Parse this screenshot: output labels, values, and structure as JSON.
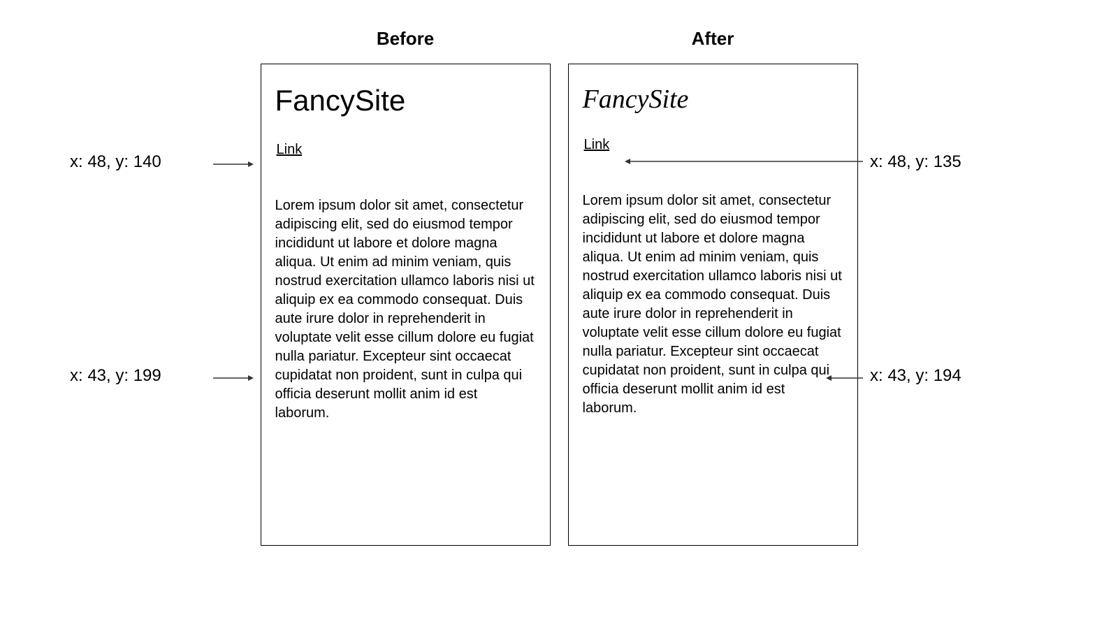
{
  "before": {
    "title": "Before",
    "site_name": "FancySite",
    "link_text": "Link",
    "body": "Lorem ipsum dolor sit amet, consectetur adipiscing elit, sed do eiusmod tempor incididunt ut labore et dolore magna aliqua. Ut enim ad minim veniam, quis nostrud exercitation ullamco laboris nisi ut aliquip ex ea commodo consequat. Duis aute irure dolor in reprehenderit in voluptate velit esse cillum dolore eu fugiat nulla pariatur. Excepteur sint occaecat cupidatat non proident, sunt in culpa qui officia deserunt mollit anim id est laborum."
  },
  "after": {
    "title": "After",
    "site_name": "FancySite",
    "link_text": "Link",
    "body": "Lorem ipsum dolor sit amet, consectetur adipiscing elit, sed do eiusmod tempor incididunt ut labore et dolore magna aliqua. Ut enim ad minim veniam, quis nostrud exercitation ullamco laboris nisi ut aliquip ex ea commodo consequat. Duis aute irure dolor in reprehenderit in voluptate velit esse cillum dolore eu fugiat nulla pariatur. Excepteur sint occaecat cupidatat non proident, sunt in culpa qui officia deserunt mollit anim id est laborum."
  },
  "annotations": {
    "left_top": "x: 48, y: 140",
    "left_bottom": "x: 43, y: 199",
    "right_top": "x: 48, y: 135",
    "right_bottom": "x: 43, y: 194"
  }
}
